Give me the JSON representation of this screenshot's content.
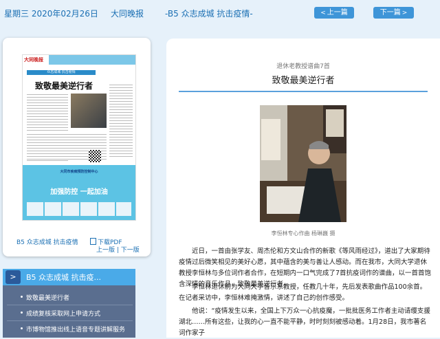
{
  "header": {
    "date": "星期三 2020年02月26日",
    "paper": "大同晚报",
    "section": "-B5 众志成城 抗击疫情-",
    "prev_label": "上一篇",
    "next_label": "下一篇"
  },
  "thumbnail": {
    "page_label": "B5 众志成城 抗击疫情",
    "pdf_label": "下载PDF",
    "prev_next": "上一版 | 下一版",
    "paper_logo": "大同晚报",
    "paper_tag": "众志成城 抗击疫情",
    "paper_title": "致敬最美逆行者",
    "ad_org": "大同市疾病预防控制中心",
    "ad_slogan": "加强防控 一起加油"
  },
  "article_list": {
    "title": "B5 众志成城 抗击疫...",
    "items": [
      "致敬最美逆行者",
      "成绩复核采取网上申请方式",
      "市博物馆推出线上语音专题讲解服务"
    ]
  },
  "article": {
    "kicker": "退休老教授谱曲7首",
    "title": "致敬最美逆行者",
    "caption": "李恒林专心作曲 杨琳巍 摄",
    "paragraphs": [
      "近日，一首由张学友、周杰伦和方文山合作的新歌《等风雨经过》，道出了大家期待疫情过后微笑相见的美好心愿，其中蕴含的美与善让人感动。而在我市，大同大学退休教授李恒林与多位词作者合作，在短期内一口气完成了7首抗疫词作的谱曲，以一首首饱含深情的音乐作品，致敬最美逆行者。",
      "李恒林退休前为大同大学音乐系教授，任教几十年，先后发表歌曲作品100余首。在记者采访中，李恒林难掩激情，讲述了自己的创作感受。",
      "他说：“疫情发生以来，全国上下万众一心抗疫魔，一批批医务工作者主动请缨支援湖北……所有这些，让我的心一直不能平静，时时刻刻被感动着。1月28日，我市著名词作家子"
    ]
  }
}
